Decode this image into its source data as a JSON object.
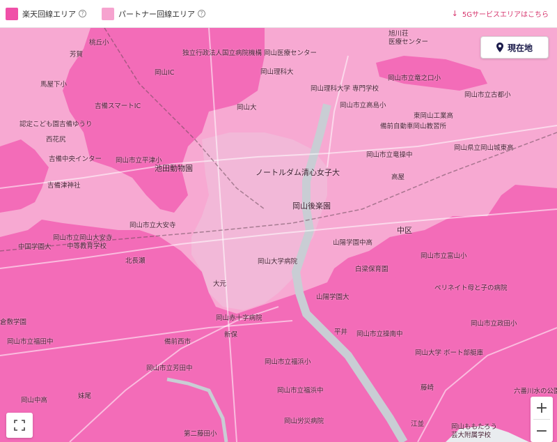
{
  "legend": {
    "rakuten": {
      "label": "楽天回線エリア",
      "color": "#f050a8"
    },
    "partner": {
      "label": "パートナー回線エリア",
      "color": "#f6a3cf"
    },
    "help_glyph": "?",
    "fiveg": {
      "label": "5Gサービスエリアはこちら",
      "arrow": "↓"
    }
  },
  "controls": {
    "locate_label": "現在地",
    "zoom_in": "+",
    "zoom_out": "−"
  },
  "colors": {
    "rakuten_area": "#f36cb8",
    "partner_area": "#f7a9d2",
    "urban_area": "#f2b8d8",
    "river": "#c9cdd4",
    "accent_text": "#1a1a4a"
  },
  "map": {
    "labels": [
      "桃丘小",
      "芳賀",
      "馬屋下小",
      "認定こども園吉備ゆうり",
      "西花尻",
      "吉備中央インター",
      "吉備津神社",
      "岡山市立平津小",
      "池田動物園",
      "岡山市立岡山大安寺",
      "中等教育学校",
      "中国学園大",
      "北長瀬",
      "岡山市立大安寺",
      "岡山大学病院",
      "倉敷学園",
      "岡山市立福田中",
      "岡山市立芳田中",
      "岡山中高",
      "独立行政法人国立病院機構 岡山医療センター",
      "岡山理科大",
      "岡山理科大学 専門学校",
      "岡山大",
      "旭川荘",
      "医療センター",
      "岡山市立竜之口小",
      "岡山市立古都小",
      "岡山市立高島小",
      "東岡山工業高",
      "備前自動車岡山教習所",
      "岡山市立竜操中",
      "岡山県立岡山城東高",
      "ノートルダム清心女子大",
      "岡山後楽園",
      "中区",
      "山陽学園中高",
      "岡山大学病院",
      "白梁保育園",
      "岡山市立富山小",
      "ペリネイト母と子の病院",
      "岡山市立操南中",
      "岡山市立政田小",
      "岡山大学 ボート部艇庫",
      "山陽学園大",
      "岡山赤十字病院",
      "岡山市立福浜小",
      "岡山市立福浜中",
      "岡山労災病院",
      "第二藤田小",
      "六番川水の公園",
      "岡山ももたろう",
      "芸大附属学校",
      "大元",
      "平井",
      "江並",
      "新保",
      "備前西市",
      "妹尾",
      "岡山IC",
      "吉備スマートIC",
      "高屋",
      "藤崎"
    ]
  }
}
